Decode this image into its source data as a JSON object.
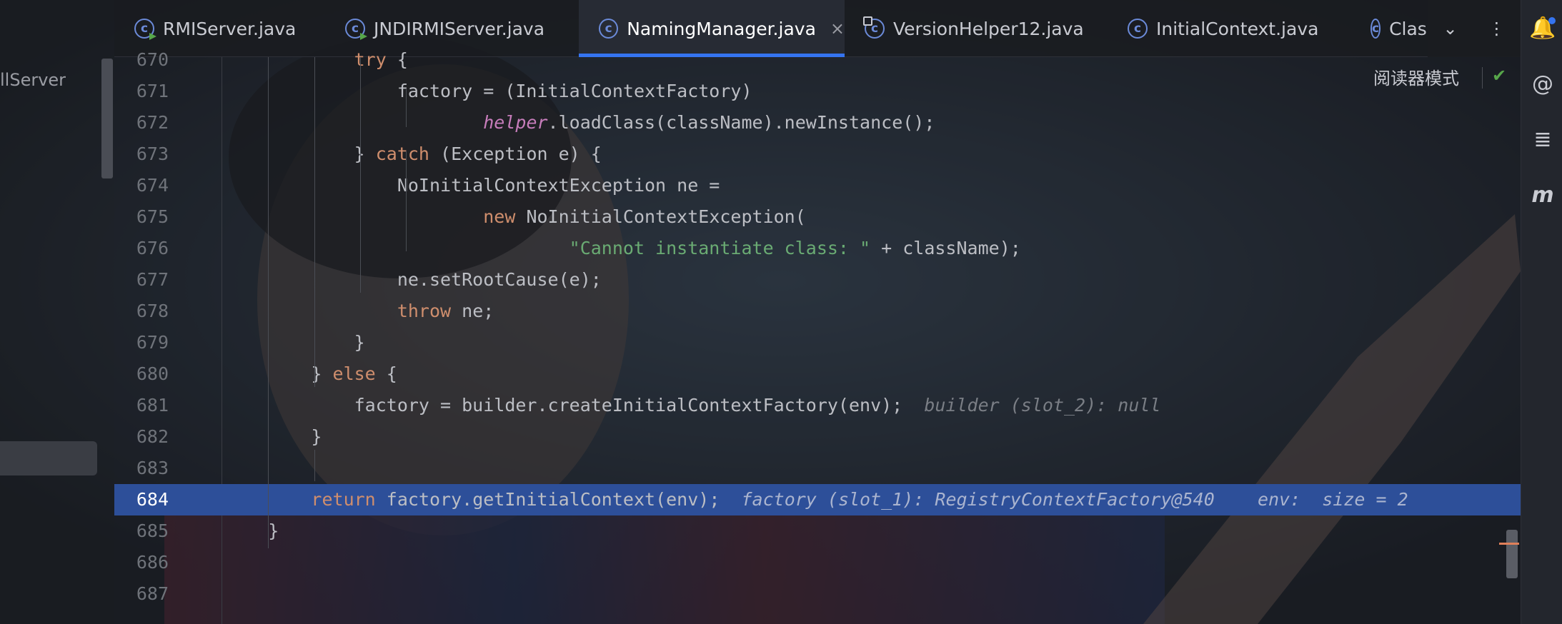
{
  "project_panel": {
    "item_label": "llServer"
  },
  "tabs": [
    {
      "label": "RMIServer.java",
      "icon": "class-run-icon",
      "active": false
    },
    {
      "label": "JNDIRMIServer.java",
      "icon": "class-run-icon",
      "active": false
    },
    {
      "label": "NamingManager.java",
      "icon": "class-icon",
      "active": true,
      "close": "×"
    },
    {
      "label": "VersionHelper12.java",
      "icon": "class-locked-icon",
      "active": false
    },
    {
      "label": "InitialContext.java",
      "icon": "class-icon",
      "active": false
    },
    {
      "label": "Class",
      "icon": "class-icon",
      "active": false
    }
  ],
  "tab_menu": {
    "chevron": "⌄",
    "more": "⋮"
  },
  "editor": {
    "reader_mode_label": "阅读器模式",
    "reader_mode_check": "✔",
    "lines": [
      {
        "n": "670",
        "segs": [
          [
            "",
            "            "
          ],
          [
            "kw",
            "try"
          ],
          [
            "",
            " {"
          ]
        ]
      },
      {
        "n": "671",
        "segs": [
          [
            "",
            "                factory = (InitialContextFactory)"
          ]
        ]
      },
      {
        "n": "672",
        "segs": [
          [
            "",
            "                        "
          ],
          [
            "fld",
            "helper"
          ],
          [
            "",
            ".loadClass(className).newInstance();"
          ]
        ]
      },
      {
        "n": "673",
        "segs": [
          [
            "",
            "            } "
          ],
          [
            "kw",
            "catch"
          ],
          [
            "",
            " (Exception e) {"
          ]
        ]
      },
      {
        "n": "674",
        "segs": [
          [
            "",
            "                NoInitialContextException ne ="
          ]
        ]
      },
      {
        "n": "675",
        "segs": [
          [
            "",
            "                        "
          ],
          [
            "kw",
            "new"
          ],
          [
            "",
            " NoInitialContextException("
          ]
        ]
      },
      {
        "n": "676",
        "segs": [
          [
            "",
            "                                "
          ],
          [
            "str",
            "\"Cannot instantiate class: \""
          ],
          [
            "",
            " + className);"
          ]
        ]
      },
      {
        "n": "677",
        "segs": [
          [
            "",
            "                ne.setRootCause(e);"
          ]
        ]
      },
      {
        "n": "678",
        "segs": [
          [
            "",
            "                "
          ],
          [
            "kw",
            "throw"
          ],
          [
            "",
            " ne;"
          ]
        ]
      },
      {
        "n": "679",
        "segs": [
          [
            "",
            "            }"
          ]
        ]
      },
      {
        "n": "680",
        "segs": [
          [
            "",
            "        } "
          ],
          [
            "kw",
            "else"
          ],
          [
            "",
            " {"
          ]
        ]
      },
      {
        "n": "681",
        "segs": [
          [
            "",
            "            factory = builder.createInitialContextFactory(env);  "
          ],
          [
            "hint",
            "builder (slot_2): null"
          ]
        ]
      },
      {
        "n": "682",
        "segs": [
          [
            "",
            "        }"
          ]
        ]
      },
      {
        "n": "683",
        "segs": [
          [
            "",
            ""
          ]
        ]
      },
      {
        "n": "684",
        "highlight": true,
        "segs": [
          [
            "",
            "        "
          ],
          [
            "kw",
            "return"
          ],
          [
            "",
            " factory.getInitialContext(env);  "
          ],
          [
            "hint",
            "factory (slot_1): RegistryContextFactory@540    env:  size = 2"
          ]
        ]
      },
      {
        "n": "685",
        "segs": [
          [
            "",
            "    }"
          ]
        ]
      },
      {
        "n": "686",
        "segs": [
          [
            "",
            ""
          ]
        ]
      },
      {
        "n": "687",
        "segs": [
          [
            "",
            ""
          ]
        ]
      }
    ]
  },
  "toolstrip": [
    {
      "name": "notifications-icon",
      "glyph": "🔔"
    },
    {
      "name": "ai-assistant-icon",
      "glyph": "@"
    },
    {
      "name": "database-icon",
      "glyph": "≣"
    },
    {
      "name": "maven-icon",
      "glyph": "m"
    }
  ]
}
